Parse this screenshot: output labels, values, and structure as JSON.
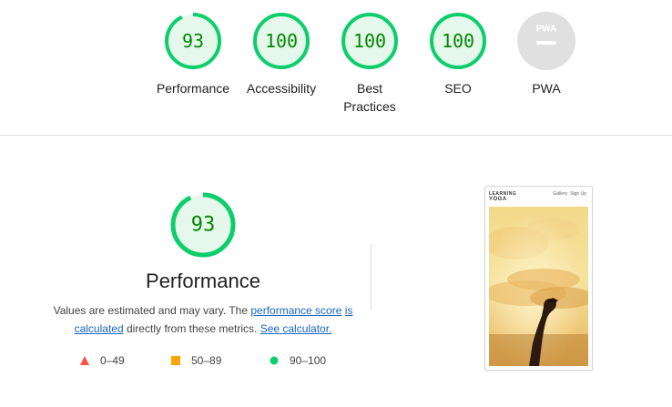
{
  "colors": {
    "pass": "#0cce6b",
    "pass_fill": "#e6f7ec",
    "pass_text": "#008800",
    "average": "#ffa400",
    "fail": "#ff4e42",
    "pwa_fill": "#e0e0e0",
    "link": "#1565c0"
  },
  "summary_gauges": [
    {
      "score": "93",
      "label": "Performance",
      "icon": "score-ring"
    },
    {
      "score": "100",
      "label": "Accessibility",
      "icon": "score-ring"
    },
    {
      "score": "100",
      "label": "Best Practices",
      "icon": "score-ring"
    },
    {
      "score": "100",
      "label": "SEO",
      "icon": "score-ring"
    },
    {
      "score": "",
      "label": "PWA",
      "badge": "PWA",
      "icon": "pwa-badge-icon"
    }
  ],
  "performance": {
    "score": "93",
    "score_fraction": 0.93,
    "title": "Performance",
    "desc_prefix": "Values are estimated and may vary. The ",
    "desc_link1": "performance score",
    "desc_link1b": "is calculated",
    "desc_middle": " directly from these metrics. ",
    "desc_link2": "See calculator."
  },
  "legend": [
    {
      "range": "0–49",
      "icon": "triangle-fail-icon"
    },
    {
      "range": "50–89",
      "icon": "square-average-icon"
    },
    {
      "range": "90–100",
      "icon": "circle-pass-icon"
    }
  ],
  "screenshot": {
    "logo_line1": "LEARNING",
    "logo_line2": "YOGA",
    "nav_1": "Gallery",
    "nav_2": "Sign Up"
  }
}
